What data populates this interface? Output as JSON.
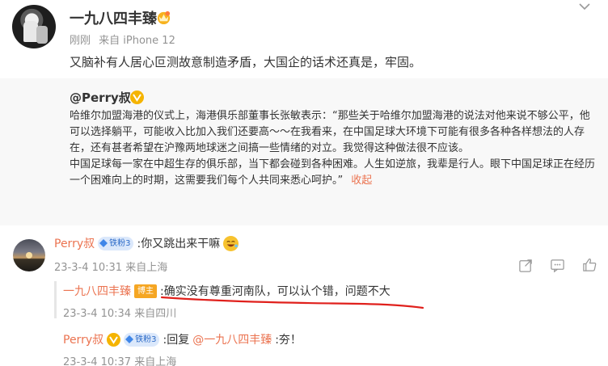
{
  "post": {
    "author": "一九八四丰臻",
    "meta_time": "刚刚",
    "meta_source": "来自 iPhone 12",
    "text": "又脑补有人居心叵测故意制造矛盾，大国企的话术还真是，牢固。"
  },
  "quote": {
    "author": "@Perry叔",
    "paragraph1": "哈维尔加盟海港的仪式上，海港俱乐部董事长张敏表示：“那些关于哈维尔加盟海港的说法对他来说不够公平，他可以选择躺平，可能收入比加入我们还要高～～在我看来，在中国足球大环境下可能有很多各种各样想法的人存在，还有甚者希望在沪豫两地球迷之间搞一些情绪的对立。我觉得这种做法很不应该。",
    "paragraph2": "中国足球每一家在中超生存的俱乐部，当下都会碰到各种困难。人生如逆旅，我辈是行人。眼下中国足球正在经历一个困难向上的时期，这需要我们每个人共同来悉心呵护。”",
    "collapse": "收起"
  },
  "comments": [
    {
      "name": "Perry叔",
      "badge": "铁粉3",
      "text": ":你又跳出来干嘛",
      "meta": "23-3-4 10:31 来自上海"
    },
    {
      "name": "一九八四丰臻",
      "badge": "博主",
      "text": ":确实没有尊重河南队，可以认个错，问题不大",
      "meta": "23-3-4 10:34 来自四川"
    },
    {
      "name": "Perry叔",
      "badge": "铁粉3",
      "text_prefix": ":回复",
      "mention": "@一九八四丰臻",
      "text_suffix": ":夯！",
      "meta": "23-3-4 10:37 来自上海"
    }
  ],
  "colors": {
    "link_orange": "#eb7350",
    "gold_v": "#f5b400",
    "annotation_red": "#e0201c",
    "badge_blue_bg": "#dbe8fb",
    "blogger_orange": "#f5a623"
  }
}
